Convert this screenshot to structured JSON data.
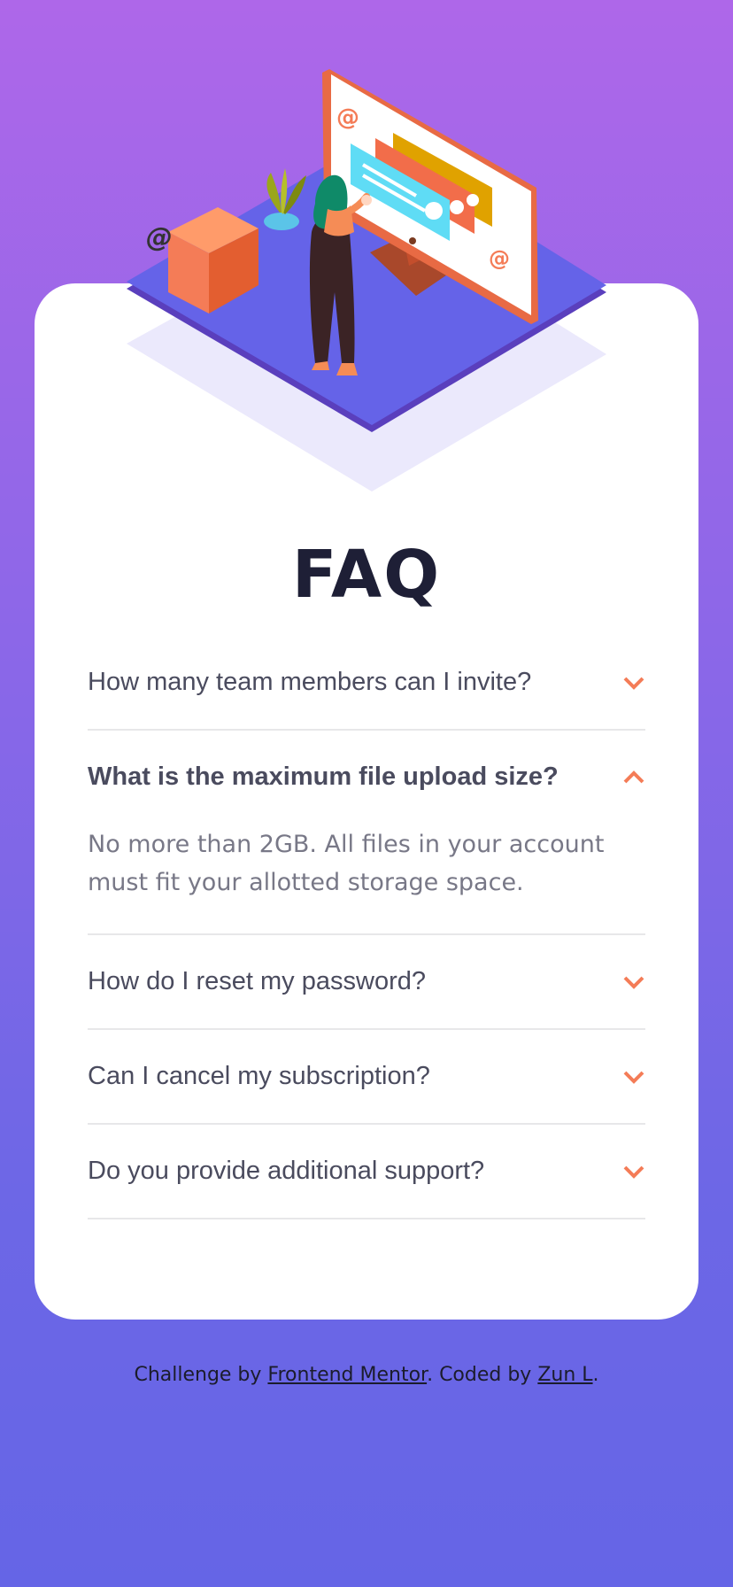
{
  "title": "FAQ",
  "faq": [
    {
      "question": "How many team members can I invite?",
      "open": false,
      "answer": ""
    },
    {
      "question": "What is the maximum file upload size?",
      "open": true,
      "answer": "No more than 2GB. All files in your account must fit your allotted storage space."
    },
    {
      "question": "How do I reset my password?",
      "open": false,
      "answer": ""
    },
    {
      "question": "Can I cancel my subscription?",
      "open": false,
      "answer": ""
    },
    {
      "question": "Do you provide additional support?",
      "open": false,
      "answer": ""
    }
  ],
  "footer": {
    "prefix": "Challenge by ",
    "link1": "Frontend Mentor",
    "middle": ". Coded by ",
    "link2": "Zun L",
    "suffix": "."
  },
  "colors": {
    "accent": "#f47c57",
    "background_top": "#ae67e9",
    "background_bottom": "#6565e6",
    "card": "#ffffff",
    "title": "#1e1f36",
    "question": "#4a4b5e",
    "answer": "#787887"
  },
  "icons": {
    "collapsed": "chevron-down-icon",
    "expanded": "chevron-up-icon"
  }
}
